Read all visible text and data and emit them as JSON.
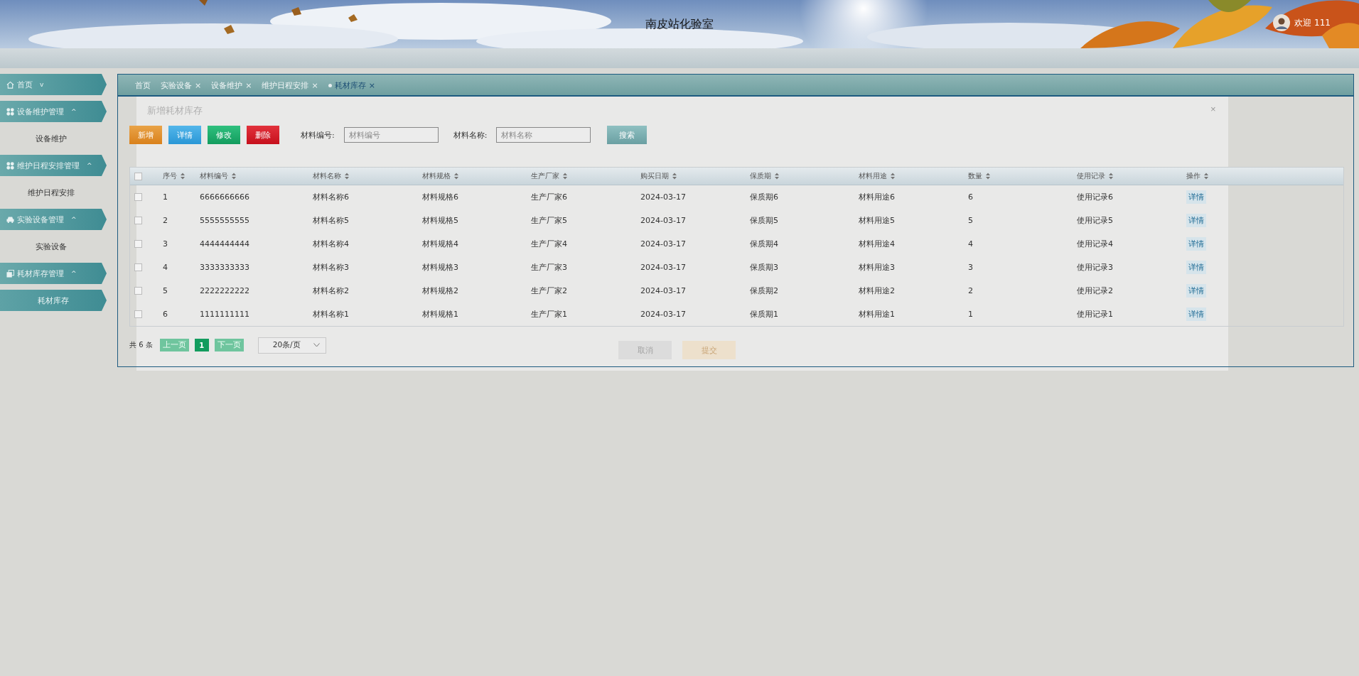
{
  "header": {
    "title": "南皮站化验室",
    "greeting": "欢迎 111"
  },
  "sidebar": {
    "items": [
      {
        "label": "首页",
        "kind": "home",
        "caret": "v"
      },
      {
        "label": "设备维护管理",
        "kind": "grid",
        "caret": "^",
        "children": [
          {
            "label": "设备维护",
            "selected": false
          }
        ]
      },
      {
        "label": "维护日程安排管理",
        "kind": "grid",
        "caret": "^",
        "children": [
          {
            "label": "维护日程安排",
            "selected": false
          }
        ]
      },
      {
        "label": "实验设备管理",
        "kind": "car",
        "caret": "^",
        "children": [
          {
            "label": "实验设备",
            "selected": false
          }
        ]
      },
      {
        "label": "耗材库存管理",
        "kind": "copy",
        "caret": "^",
        "children": [
          {
            "label": "耗材库存",
            "selected": true
          }
        ]
      }
    ]
  },
  "tabs": [
    {
      "label": "首页",
      "selected": false
    },
    {
      "label": "实验设备",
      "close": "×",
      "selected": false
    },
    {
      "label": "设备维护",
      "close": "×",
      "selected": false
    },
    {
      "label": "维护日程安排",
      "close": "×",
      "selected": false
    },
    {
      "label": "耗材库存",
      "close": "×",
      "selected": true
    }
  ],
  "modal": {
    "title": "新增耗材库存",
    "close": "×",
    "buttons": [
      {
        "label": "取消",
        "kind": "cancel"
      },
      {
        "label": "提交",
        "kind": "submit"
      }
    ]
  },
  "toolbar": {
    "buttons": [
      {
        "label": "新增",
        "kind": "add"
      },
      {
        "label": "详情",
        "kind": "detail"
      },
      {
        "label": "修改",
        "kind": "edit"
      },
      {
        "label": "删除",
        "kind": "delete"
      }
    ],
    "filters": [
      {
        "label": "材料编号:",
        "placeholder": "材料编号"
      },
      {
        "label": "材料名称:",
        "placeholder": "材料名称"
      }
    ],
    "search": "搜索"
  },
  "table": {
    "header_checked": false,
    "columns": [
      "序号",
      "材料编号",
      "材料名称",
      "材料规格",
      "生产厂家",
      "购买日期",
      "保质期",
      "材料用途",
      "数量",
      "使用记录",
      "操作"
    ],
    "rows": [
      {
        "checked": false,
        "cells": [
          "1",
          "6666666666",
          "材料名称6",
          "材料规格6",
          "生产厂家6",
          "2024-03-17",
          "保质期6",
          "材料用途6",
          "6",
          "使用记录6"
        ],
        "action": "详情"
      },
      {
        "checked": false,
        "cells": [
          "2",
          "5555555555",
          "材料名称5",
          "材料规格5",
          "生产厂家5",
          "2024-03-17",
          "保质期5",
          "材料用途5",
          "5",
          "使用记录5"
        ],
        "action": "详情"
      },
      {
        "checked": false,
        "cells": [
          "3",
          "4444444444",
          "材料名称4",
          "材料规格4",
          "生产厂家4",
          "2024-03-17",
          "保质期4",
          "材料用途4",
          "4",
          "使用记录4"
        ],
        "action": "详情"
      },
      {
        "checked": false,
        "cells": [
          "4",
          "3333333333",
          "材料名称3",
          "材料规格3",
          "生产厂家3",
          "2024-03-17",
          "保质期3",
          "材料用途3",
          "3",
          "使用记录3"
        ],
        "action": "详情"
      },
      {
        "checked": false,
        "cells": [
          "5",
          "2222222222",
          "材料名称2",
          "材料规格2",
          "生产厂家2",
          "2024-03-17",
          "保质期2",
          "材料用途2",
          "2",
          "使用记录2"
        ],
        "action": "详情"
      },
      {
        "checked": false,
        "cells": [
          "6",
          "1111111111",
          "材料名称1",
          "材料规格1",
          "生产厂家1",
          "2024-03-17",
          "保质期1",
          "材料用途1",
          "1",
          "使用记录1"
        ],
        "action": "详情"
      }
    ]
  },
  "pagination": {
    "total": "共 6 条",
    "prev": "上一页",
    "pages": [
      {
        "label": "1",
        "selected": true
      }
    ],
    "next": "下一页",
    "page_size": "20条/页"
  }
}
